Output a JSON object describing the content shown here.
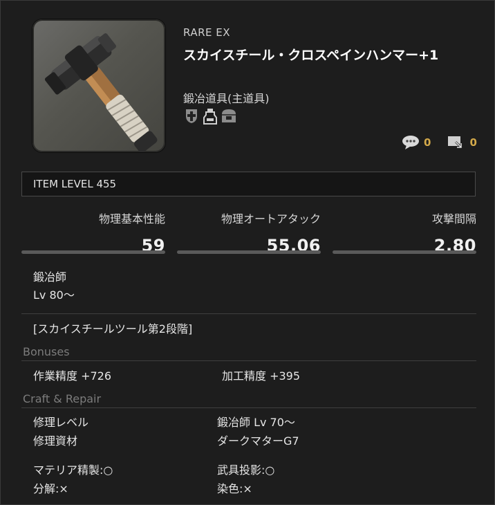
{
  "item": {
    "rarity": "RARE EX",
    "name": "スカイスチール・クロスペインハンマー+1",
    "category": "鍛冶道具(主道具)",
    "icons": [
      "crossed-shield-icon",
      "dye-bottle-icon",
      "glamour-chest-icon"
    ]
  },
  "social": {
    "comments": "0",
    "shares": "0"
  },
  "item_level": "ITEM LEVEL 455",
  "stats": [
    {
      "label": "物理基本性能",
      "value": "59"
    },
    {
      "label": "物理オートアタック",
      "value": "55.06"
    },
    {
      "label": "攻撃間隔",
      "value": "2.80"
    }
  ],
  "job": {
    "class": "鍛冶師",
    "level": "Lv 80〜"
  },
  "set_note": "[スカイスチールツール第2段階]",
  "bonuses": {
    "title": "Bonuses",
    "left": "作業精度 +726",
    "right": "加工精度 +395"
  },
  "craft_repair": {
    "title": "Craft & Repair",
    "repair_level_label": "修理レベル",
    "repair_level_value": "鍛冶師 Lv 70〜",
    "repair_material_label": "修理資材",
    "repair_material_value": "ダークマターG7",
    "materia": "マテリア精製:○",
    "projection": "武具投影:○",
    "desynth": "分解:×",
    "dye": "染色:×"
  }
}
